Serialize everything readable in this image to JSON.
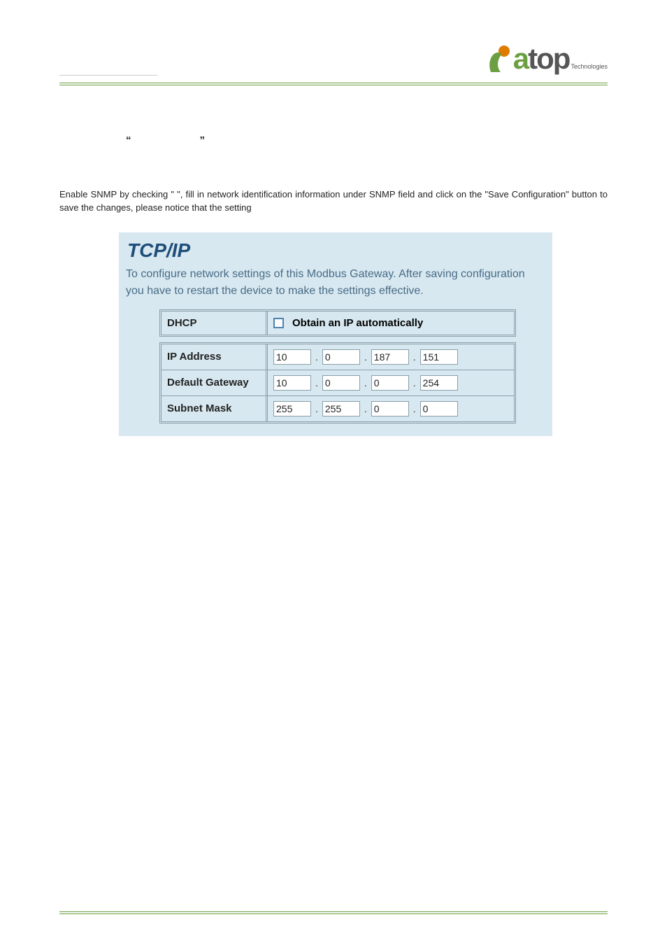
{
  "brand": {
    "pre": "a",
    "main": "top",
    "sub": "Technologies"
  },
  "instruction": "Enable SNMP by checking \"            \", fill in network identification information under SNMP field and click on the \"Save Configuration\" button to save the changes, please notice that the setting",
  "panel": {
    "title": "TCP/IP",
    "desc": "To configure network settings of this Modbus Gateway. After saving configuration you have to restart the device to make the settings effective."
  },
  "rows": {
    "dhcp": {
      "label": "DHCP",
      "text": "Obtain an IP automatically"
    },
    "ip": {
      "label": "IP Address",
      "oct": [
        "10",
        "0",
        "187",
        "151"
      ]
    },
    "gw": {
      "label": "Default Gateway",
      "oct": [
        "10",
        "0",
        "0",
        "254"
      ]
    },
    "mask": {
      "label": "Subnet Mask",
      "oct": [
        "255",
        "255",
        "0",
        "0"
      ]
    }
  }
}
